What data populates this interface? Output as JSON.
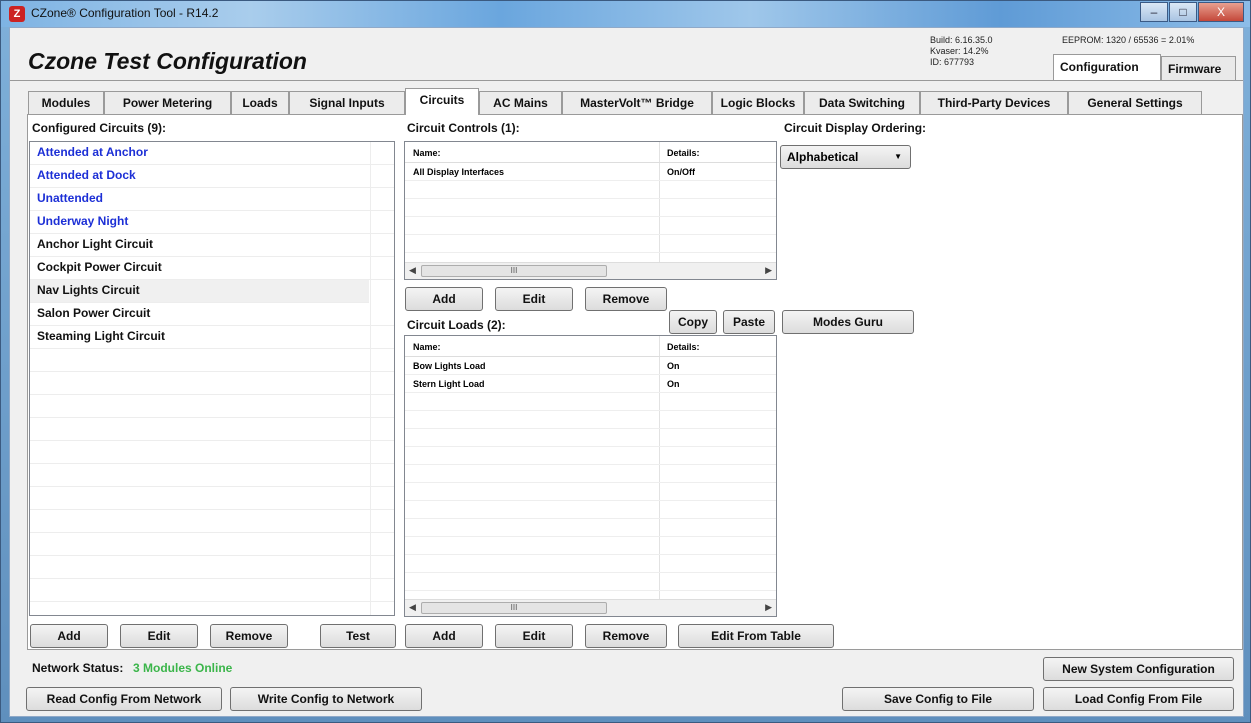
{
  "window": {
    "title": "CZone® Configuration Tool - R14.2",
    "app_icon_letter": "Z",
    "minimize": "–",
    "maximize": "□",
    "close": "X"
  },
  "header": {
    "config_title": "Czone Test Configuration",
    "build": "Build: 6.16.35.0",
    "kvaser": "Kvaser: 14.2%",
    "id": "ID: 677793",
    "eeprom": "EEPROM: 1320 / 65536 = 2.01%"
  },
  "top_tabs": [
    "Configuration",
    "Firmware"
  ],
  "tabs": [
    "Modules",
    "Power Metering",
    "Loads",
    "Signal Inputs",
    "Circuits",
    "AC Mains",
    "MasterVolt™ Bridge",
    "Logic Blocks",
    "Data Switching",
    "Third-Party Devices",
    "General Settings"
  ],
  "configured": {
    "label": "Configured Circuits (9):",
    "items": [
      "Attended at Anchor",
      "Attended at Dock",
      "Unattended",
      "Underway Night",
      "Anchor Light Circuit",
      "Cockpit Power Circuit",
      "Nav Lights Circuit",
      "Salon Power Circuit",
      "Steaming Light Circuit"
    ],
    "add": "Add",
    "edit": "Edit",
    "remove": "Remove",
    "test": "Test"
  },
  "controls": {
    "label": "Circuit Controls (1):",
    "col_name": "Name:",
    "col_details": "Details:",
    "rows": [
      {
        "name": "All Display Interfaces",
        "details": "On/Off"
      }
    ],
    "add": "Add",
    "edit": "Edit",
    "remove": "Remove"
  },
  "loads": {
    "label": "Circuit Loads (2):",
    "col_name": "Name:",
    "col_details": "Details:",
    "rows": [
      {
        "name": "Bow Lights Load",
        "details": "On"
      },
      {
        "name": "Stern Light Load",
        "details": "On"
      }
    ],
    "copy": "Copy",
    "paste": "Paste",
    "add": "Add",
    "edit": "Edit",
    "remove": "Remove",
    "edit_from_table": "Edit From Table"
  },
  "ordering": {
    "label": "Circuit Display Ordering:",
    "selected": "Alphabetical",
    "modes_guru": "Modes Guru"
  },
  "scroll_thumb": "III",
  "network": {
    "label": "Network Status:",
    "value": "3 Modules Online"
  },
  "footer": {
    "read": "Read Config From Network",
    "write": "Write Config to Network",
    "save": "Save Config to File",
    "load": "Load Config From File",
    "new_system": "New System Configuration"
  }
}
